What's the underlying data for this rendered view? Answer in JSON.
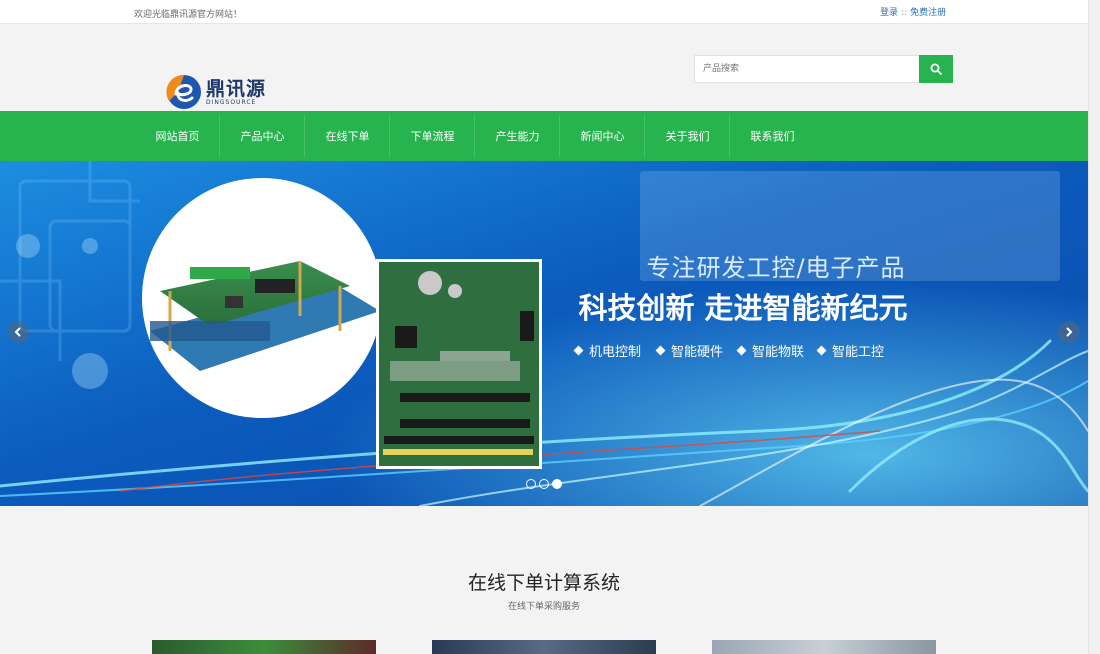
{
  "topbar": {
    "welcome": "欢迎光临鼎讯源官方网站！",
    "login": "登录",
    "separator": "::",
    "register": "免费注册"
  },
  "logo": {
    "cn": "鼎讯源",
    "en": "DINGSOURCE"
  },
  "search": {
    "placeholder": "产品搜索"
  },
  "nav": {
    "items": [
      "网站首页",
      "产品中心",
      "在线下单",
      "下单流程",
      "产生能力",
      "新闻中心",
      "关于我们",
      "联系我们"
    ]
  },
  "banner": {
    "headline_1": "专注研发工控/电子产品",
    "headline_2": "科技创新  走进智能新纪元",
    "features": [
      "机电控制",
      "智能硬件",
      "智能物联",
      "智能工控"
    ],
    "slide_count": 3,
    "active_slide": 3
  },
  "section": {
    "title": "在线下单计算系统",
    "subtitle": "在线下单采购服务"
  },
  "colors": {
    "brand_green": "#27b34e",
    "banner_blue": "#0e63c3",
    "logo_orange": "#f08a1c",
    "logo_blue": "#1f56b0"
  }
}
